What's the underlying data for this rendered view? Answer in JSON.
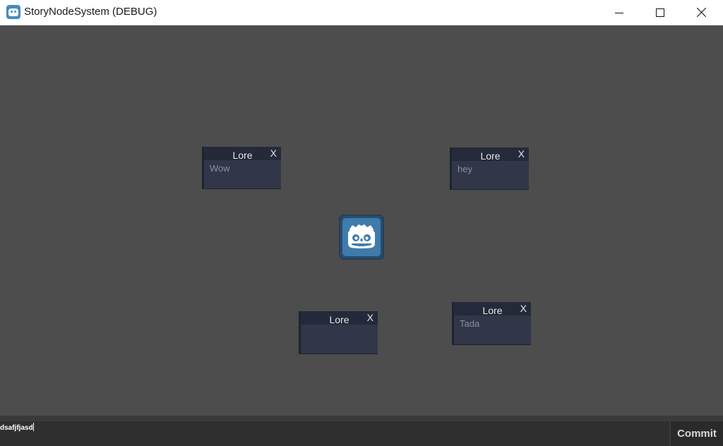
{
  "window": {
    "title": "StoryNodeSystem (DEBUG)",
    "icon": "godot-icon"
  },
  "nodes": [
    {
      "title": "Lore",
      "close_label": "X",
      "text": "Wow"
    },
    {
      "title": "Lore",
      "close_label": "X",
      "text": "hey"
    },
    {
      "title": "Lore",
      "close_label": "X",
      "text": ""
    },
    {
      "title": "Lore",
      "close_label": "X",
      "text": "Tada"
    }
  ],
  "center_logo": "godot-logo-icon",
  "command": {
    "value": "dsafjfjasd",
    "commit_label": "Commit"
  },
  "colors": {
    "canvas": "#4d4d4d",
    "node_body": "#313749",
    "node_header": "#252a3a",
    "logo": "#478cbf"
  }
}
